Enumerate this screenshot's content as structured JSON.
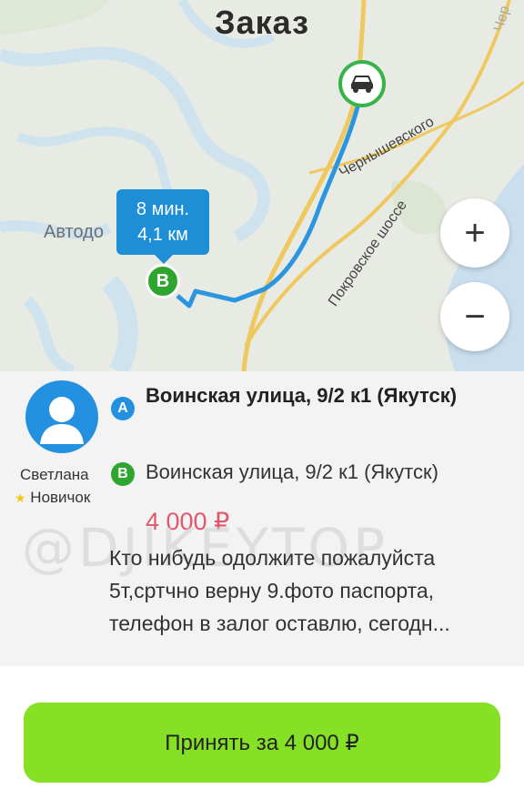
{
  "header": {
    "title": "Заказ"
  },
  "map": {
    "place_label": "Автодо",
    "streets": [
      "Чернышевского",
      "Покровское шоссе",
      "Чер"
    ],
    "eta": {
      "time": "8 мин.",
      "distance": "4,1 км"
    },
    "pin_b_label": "B",
    "zoom_in": "+",
    "zoom_out": "−",
    "route_color": "#2b95df"
  },
  "client": {
    "name": "Светлана",
    "rank": "Новичок"
  },
  "order": {
    "point_a_badge": "A",
    "point_a": "Воинская улица, 9/2 к1 (Якутск)",
    "point_b_badge": "B",
    "point_b": "Воинская улица, 9/2 к1 (Якутск)",
    "price": "4 000 ₽",
    "comment": "Кто нибудь одолжите пожалуйста 5т,сртчно верну 9.фото паспорта, телефон в залог оставлю, сегодн..."
  },
  "watermark": "@DJIKEYTOP",
  "accept_button": {
    "label": "Принять за 4 000 ₽",
    "color": "#86e026"
  }
}
